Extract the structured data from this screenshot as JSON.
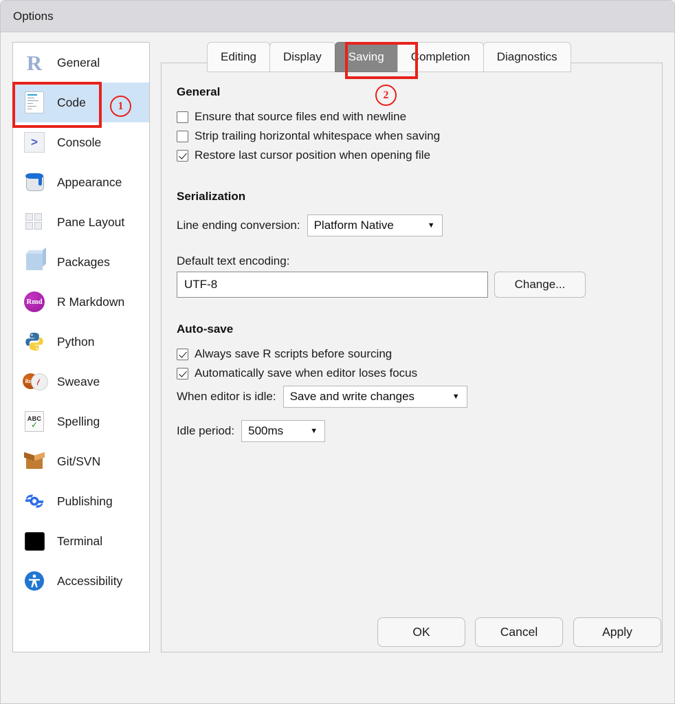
{
  "window": {
    "title": "Options"
  },
  "sidebar": {
    "items": [
      {
        "label": "General",
        "icon": "r-logo-icon",
        "selected": false
      },
      {
        "label": "Code",
        "icon": "code-document-icon",
        "selected": true
      },
      {
        "label": "Console",
        "icon": "console-prompt-icon",
        "selected": false
      },
      {
        "label": "Appearance",
        "icon": "paint-can-icon",
        "selected": false
      },
      {
        "label": "Pane Layout",
        "icon": "pane-grid-icon",
        "selected": false
      },
      {
        "label": "Packages",
        "icon": "package-cube-icon",
        "selected": false
      },
      {
        "label": "R Markdown",
        "icon": "rmd-badge-icon",
        "selected": false
      },
      {
        "label": "Python",
        "icon": "python-logo-icon",
        "selected": false
      },
      {
        "label": "Sweave",
        "icon": "sweave-rnw-pdf-icon",
        "selected": false
      },
      {
        "label": "Spelling",
        "icon": "abc-check-icon",
        "selected": false
      },
      {
        "label": "Git/SVN",
        "icon": "cardboard-box-icon",
        "selected": false
      },
      {
        "label": "Publishing",
        "icon": "publishing-icon",
        "selected": false
      },
      {
        "label": "Terminal",
        "icon": "terminal-black-icon",
        "selected": false
      },
      {
        "label": "Accessibility",
        "icon": "accessibility-icon",
        "selected": false
      }
    ]
  },
  "tabs": [
    {
      "label": "Editing",
      "active": false
    },
    {
      "label": "Display",
      "active": false
    },
    {
      "label": "Saving",
      "active": true
    },
    {
      "label": "Completion",
      "active": false
    },
    {
      "label": "Diagnostics",
      "active": false
    }
  ],
  "saving": {
    "general": {
      "heading": "General",
      "checkboxes": [
        {
          "label": "Ensure that source files end with newline",
          "checked": false
        },
        {
          "label": "Strip trailing horizontal whitespace when saving",
          "checked": false
        },
        {
          "label": "Restore last cursor position when opening file",
          "checked": true
        }
      ]
    },
    "serialization": {
      "heading": "Serialization",
      "line_ending_label": "Line ending conversion:",
      "line_ending_value": "Platform Native",
      "encoding_label": "Default text encoding:",
      "encoding_value": "UTF-8",
      "change_button": "Change..."
    },
    "autosave": {
      "heading": "Auto-save",
      "checkboxes": [
        {
          "label": "Always save R scripts before sourcing",
          "checked": true
        },
        {
          "label": "Automatically save when editor loses focus",
          "checked": true
        }
      ],
      "idle_action_label": "When editor is idle:",
      "idle_action_value": "Save and write changes",
      "idle_period_label": "Idle period:",
      "idle_period_value": "500ms"
    }
  },
  "footer": {
    "ok": "OK",
    "cancel": "Cancel",
    "apply": "Apply"
  },
  "annotations": [
    {
      "id": "marker-1",
      "label": "①",
      "text": "1"
    },
    {
      "id": "marker-2",
      "label": "②",
      "text": "2"
    }
  ],
  "icons": {
    "caret_down": "▼",
    "console_prompt": ">",
    "rmd_text": "Rmd",
    "rnw_text": "Rnw",
    "abc_text": "ABC",
    "check_text": "✓",
    "r_text": "R"
  },
  "colors": {
    "selection_blue": "#cfe3f6",
    "annotation_red": "#e8221c",
    "active_tab_gray": "#868686",
    "titlebar_gray": "#dadade"
  }
}
